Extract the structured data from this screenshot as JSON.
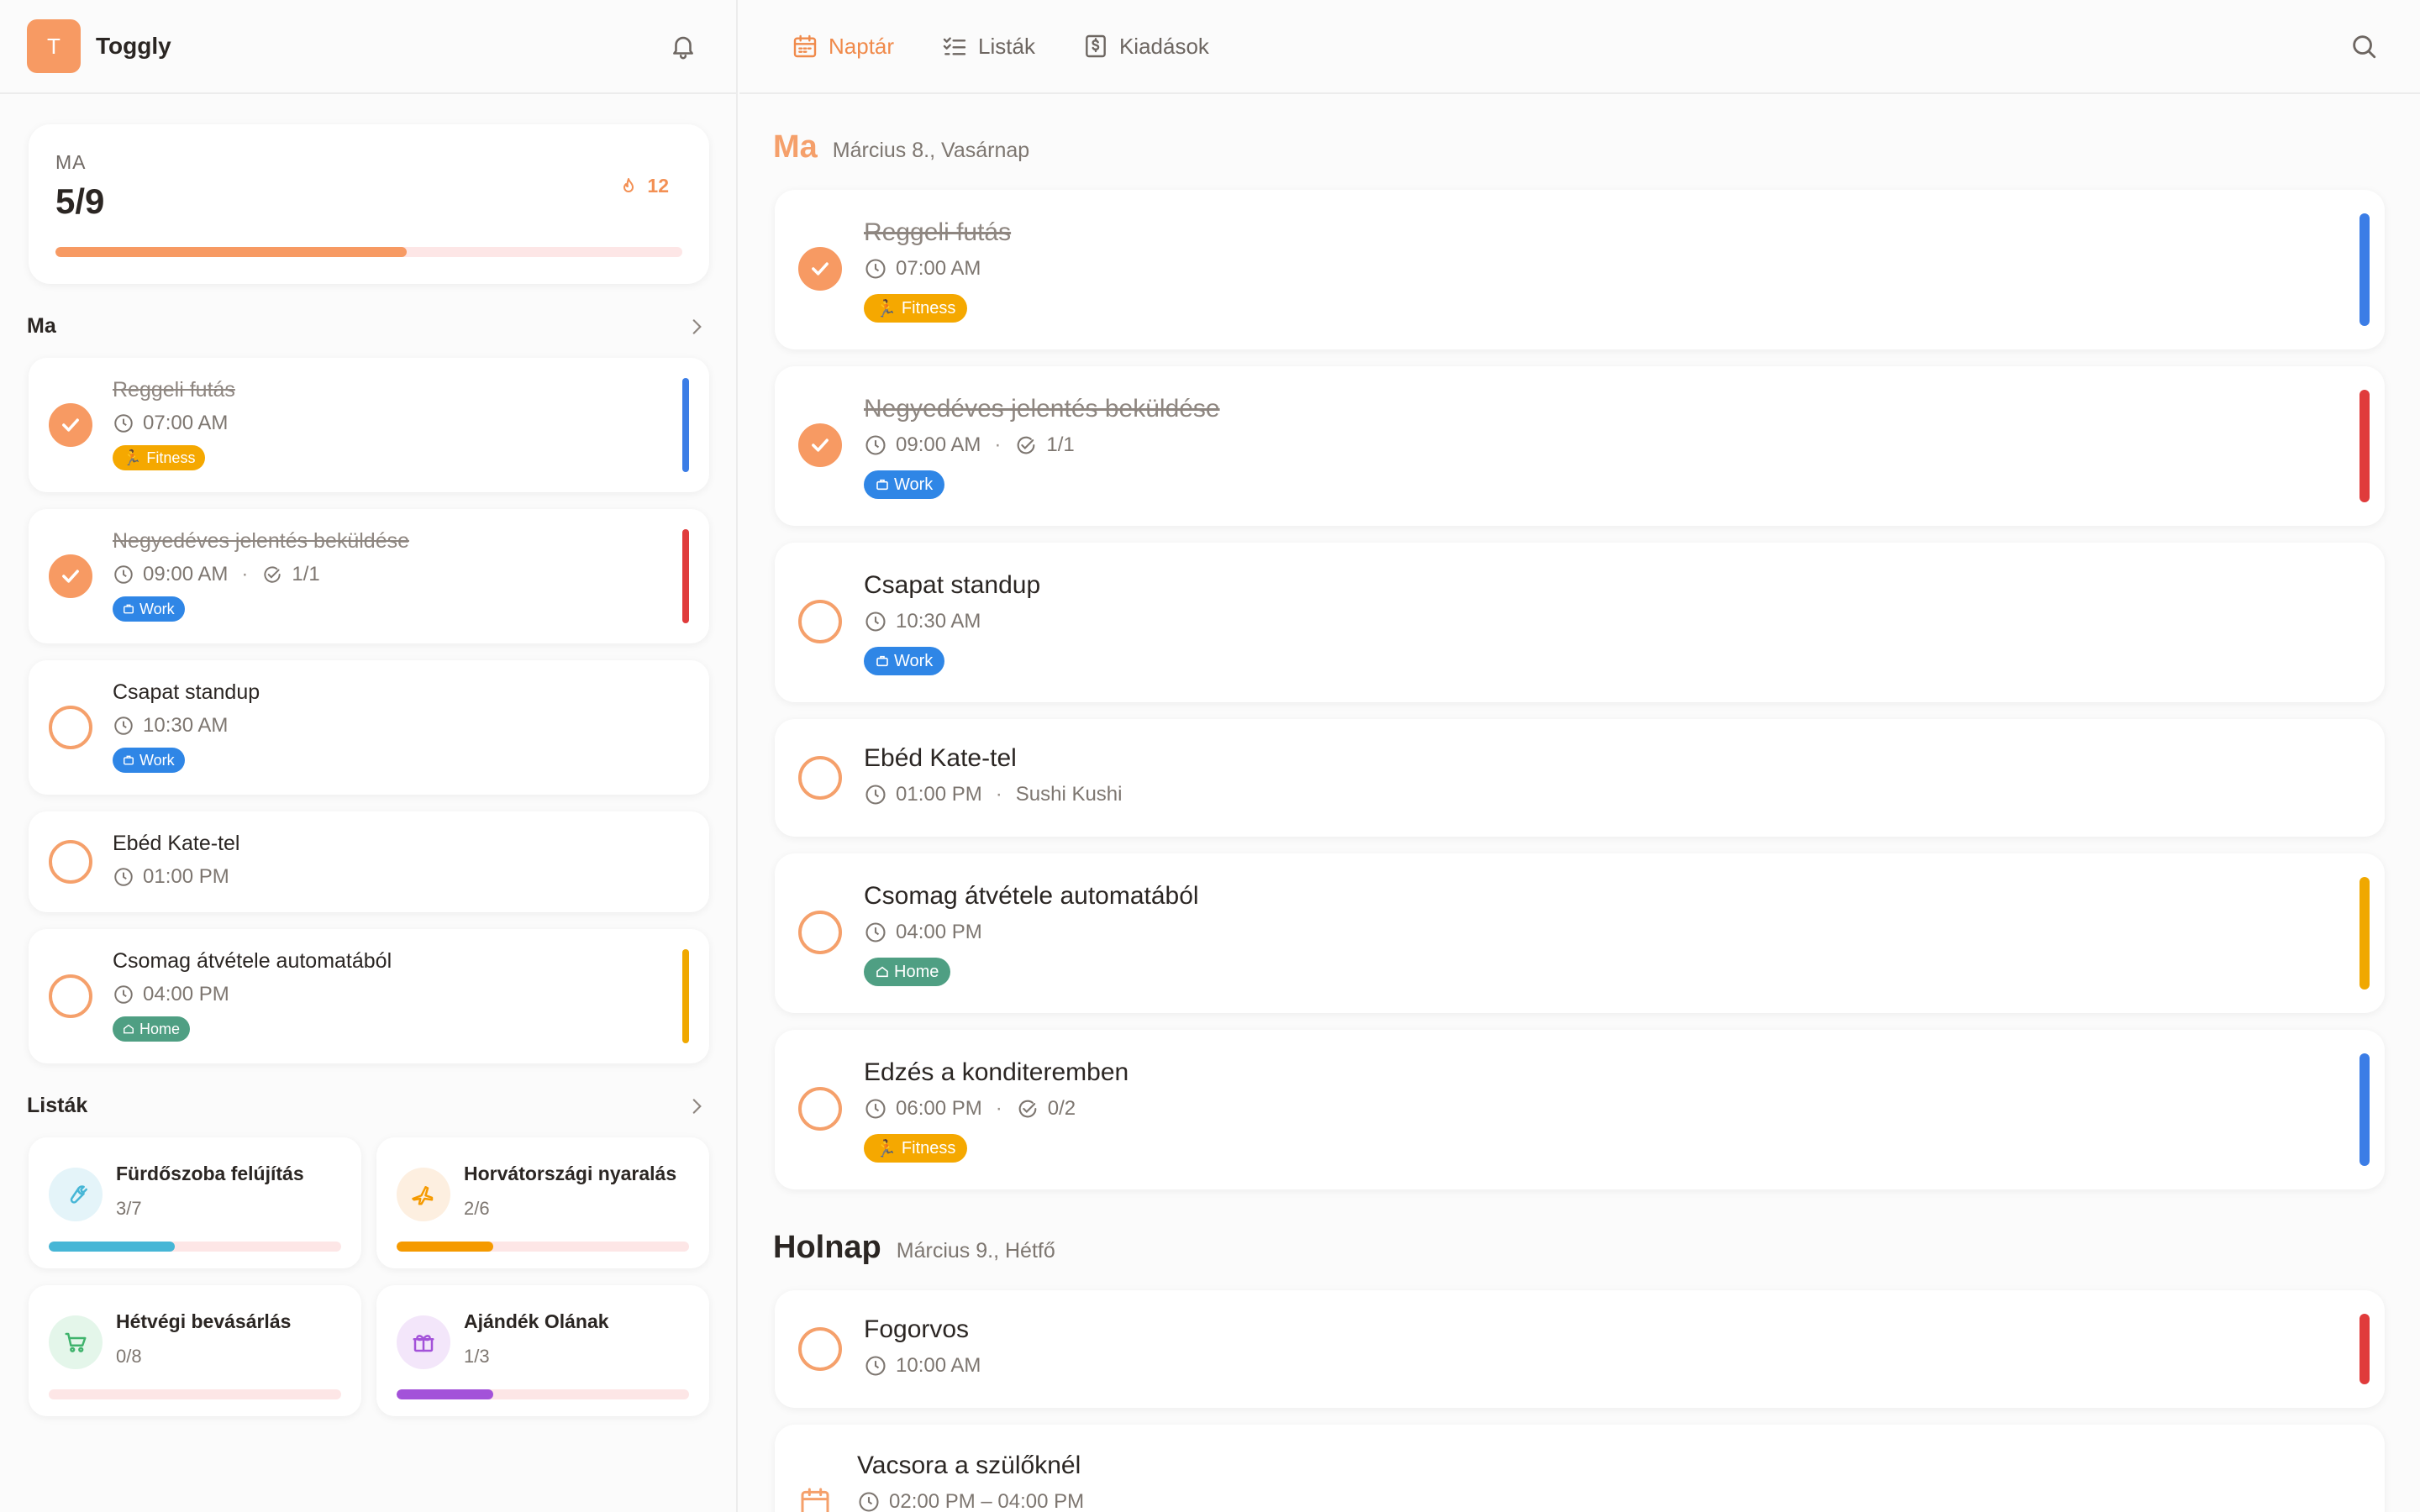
{
  "app": {
    "logo_letter": "T",
    "name": "Toggly"
  },
  "today_summary": {
    "label": "MA",
    "count": "5/9",
    "streak": "12",
    "progress": 0.56
  },
  "sidebar": {
    "today_section_title": "Ma",
    "lists_section_title": "Listák",
    "tasks": [
      {
        "title": "Reggeli futás",
        "time": "07:00 AM",
        "done": true,
        "tag": "Fitness",
        "bar_color": "#3b7de6"
      },
      {
        "title": "Negyedéves jelentés beküldése",
        "time": "09:00 AM",
        "subtasks": "1/1",
        "done": true,
        "tag": "Work",
        "bar_color": "#e03b3b"
      },
      {
        "title": "Csapat standup",
        "time": "10:30 AM",
        "done": false,
        "tag": "Work"
      },
      {
        "title": "Ebéd Kate-tel",
        "time": "01:00 PM",
        "done": false
      },
      {
        "title": "Csomag átvétele automatából",
        "time": "04:00 PM",
        "done": false,
        "tag": "Home",
        "bar_color": "#f0a800"
      }
    ],
    "lists": [
      {
        "name": "Fürdőszoba felújítás",
        "count": "3/7",
        "progress": 0.43,
        "color": "#46b6d6",
        "icon": "wrench-icon"
      },
      {
        "name": "Horvátországi nyaralás",
        "count": "2/6",
        "progress": 0.33,
        "color": "#f59a00",
        "icon": "plane-icon"
      },
      {
        "name": "Hétvégi bevásárlás",
        "count": "0/8",
        "progress": 0.0,
        "color": "#3fb36c",
        "icon": "cart-icon"
      },
      {
        "name": "Ajándék Olának",
        "count": "1/3",
        "progress": 0.33,
        "color": "#a352d9",
        "icon": "gift-icon"
      }
    ]
  },
  "nav": {
    "calendar": "Naptár",
    "lists": "Listák",
    "expenses": "Kiadások"
  },
  "main": {
    "today": {
      "name": "Ma",
      "date": "Március 8., Vasárnap"
    },
    "tomorrow": {
      "name": "Holnap",
      "date": "Március 9., Hétfő"
    },
    "tasks": [
      {
        "title": "Reggeli futás",
        "time": "07:00 AM",
        "done": true,
        "tag": "Fitness",
        "bar_color": "#3b7de6"
      },
      {
        "title": "Negyedéves jelentés beküldése",
        "time": "09:00 AM",
        "subtasks": "1/1",
        "done": true,
        "tag": "Work",
        "bar_color": "#e03b3b"
      },
      {
        "title": "Csapat standup",
        "time": "10:30 AM",
        "done": false,
        "tag": "Work"
      },
      {
        "title": "Ebéd Kate-tel",
        "time": "01:00 PM",
        "location": "Sushi Kushi",
        "done": false
      },
      {
        "title": "Csomag átvétele automatából",
        "time": "04:00 PM",
        "done": false,
        "tag": "Home",
        "bar_color": "#f0a800"
      },
      {
        "title": "Edzés a konditeremben",
        "time": "06:00 PM",
        "subtasks": "0/2",
        "done": false,
        "tag": "Fitness",
        "bar_color": "#3b7de6"
      }
    ],
    "tomorrow_tasks": [
      {
        "title": "Fogorvos",
        "time": "10:00 AM",
        "done": false,
        "bar_color": "#e03b3b"
      },
      {
        "title": "Vacsora a szülőknél",
        "time": "02:00 PM – 04:00 PM"
      }
    ]
  }
}
